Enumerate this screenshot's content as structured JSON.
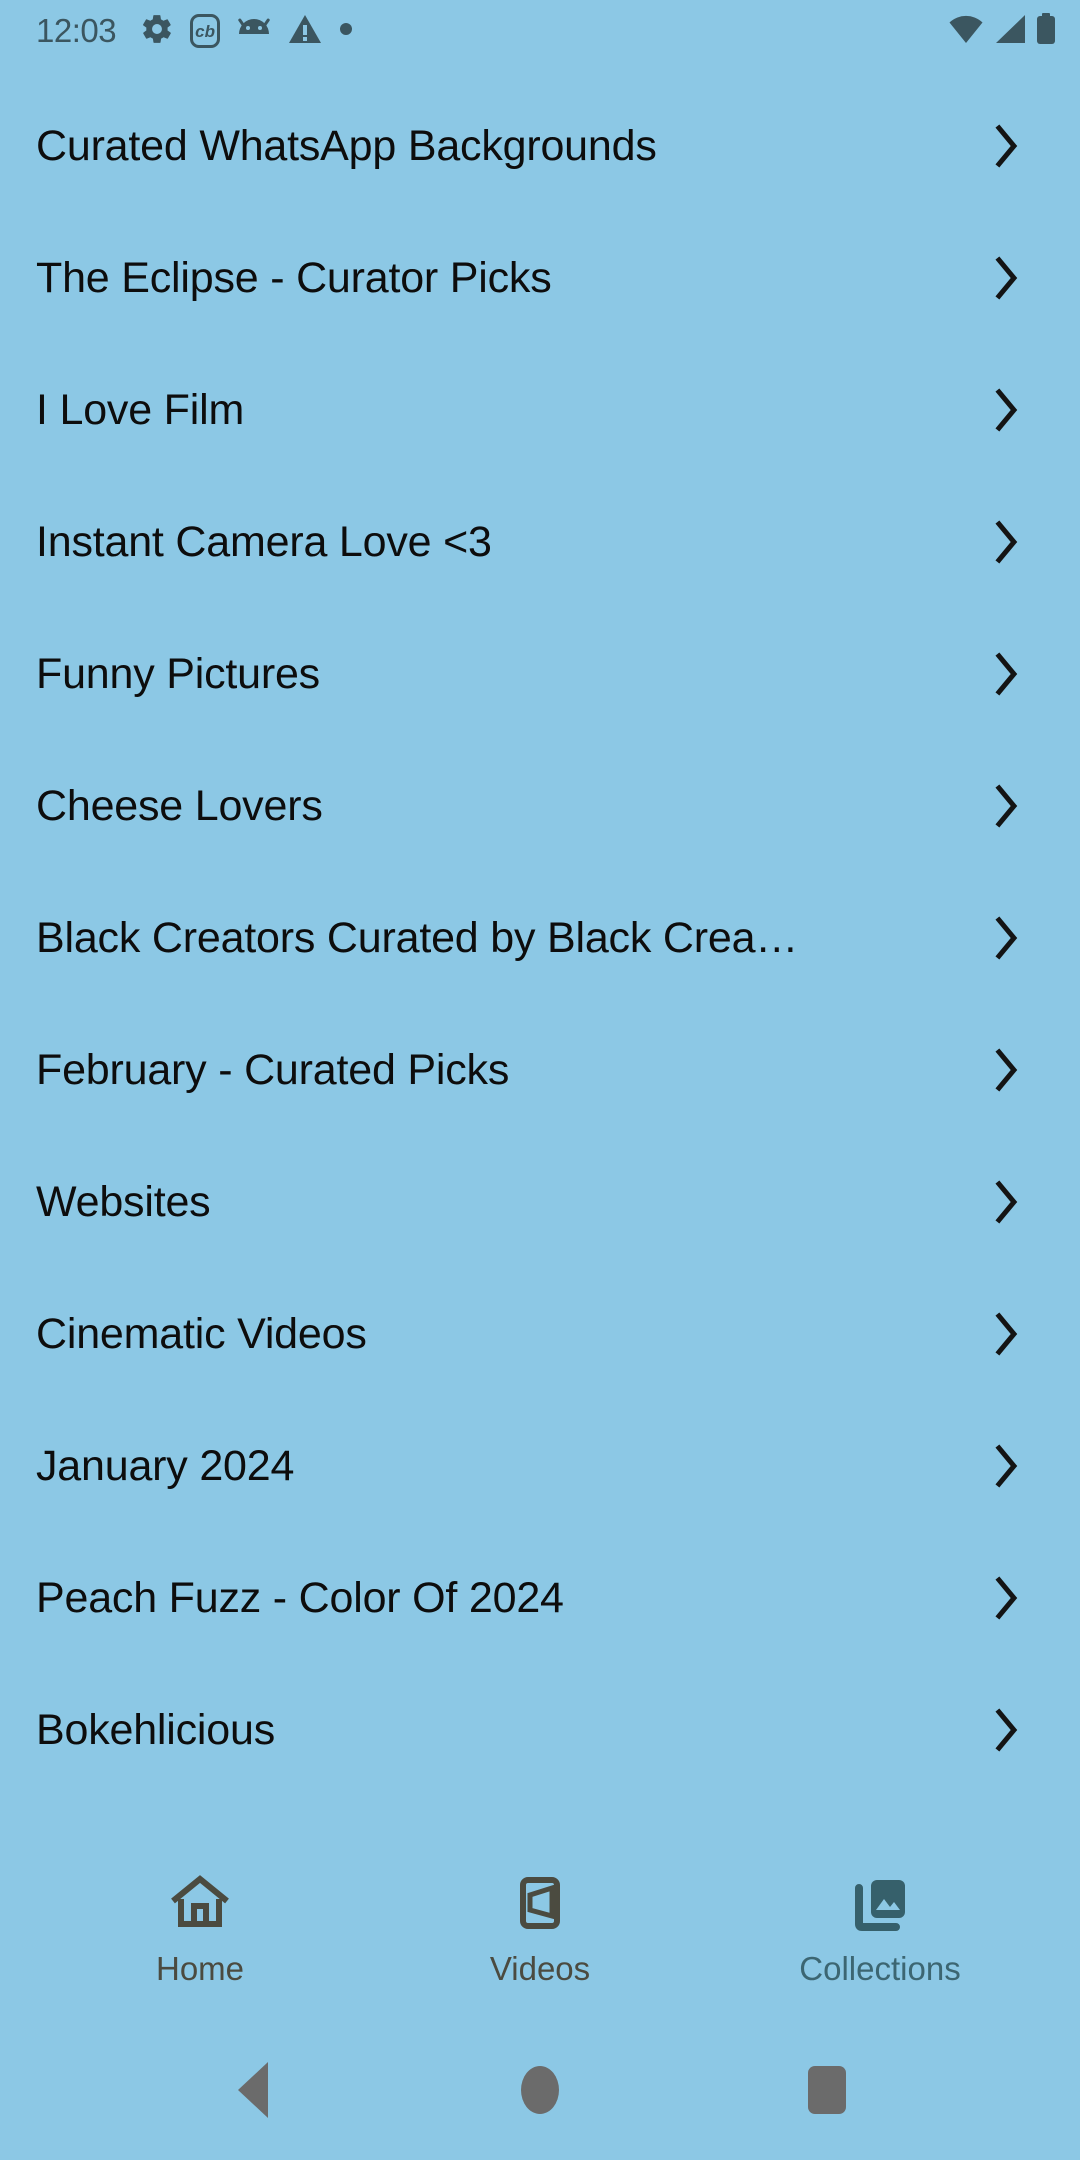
{
  "status_bar": {
    "time": "12:03",
    "left_icons": [
      "gear-icon",
      "cb-badge-icon",
      "android-icon",
      "warning-triangle-icon",
      "dot-icon"
    ],
    "cb_badge_text": "cb",
    "right_icons": [
      "wifi-icon",
      "cell-signal-icon",
      "battery-icon"
    ]
  },
  "colors": {
    "background": "#8cc8e5",
    "list_text": "#0d0d0d",
    "status_icon": "#3b5660",
    "nav_icon": "#4b4b40",
    "nav_selected": "#3c6672",
    "system_nav": "#6b6b6b"
  },
  "collections": {
    "items": [
      {
        "label": "Curated WhatsApp Backgrounds"
      },
      {
        "label": "The Eclipse - Curator Picks"
      },
      {
        "label": "I Love Film"
      },
      {
        "label": "Instant Camera Love <3"
      },
      {
        "label": "Funny Pictures"
      },
      {
        "label": "Cheese Lovers"
      },
      {
        "label": "Black Creators Curated by Black Crea…"
      },
      {
        "label": "February - Curated Picks"
      },
      {
        "label": "Websites"
      },
      {
        "label": "Cinematic Videos"
      },
      {
        "label": "January 2024"
      },
      {
        "label": "Peach Fuzz - Color Of 2024"
      },
      {
        "label": "Bokehlicious"
      }
    ]
  },
  "bottom_nav": {
    "tabs": [
      {
        "label": "Home",
        "icon": "home-icon",
        "selected": false
      },
      {
        "label": "Videos",
        "icon": "videos-icon",
        "selected": false
      },
      {
        "label": "Collections",
        "icon": "collections-icon",
        "selected": true
      }
    ]
  },
  "system_nav": {
    "buttons": [
      {
        "name": "back-button"
      },
      {
        "name": "home-button"
      },
      {
        "name": "recents-button"
      }
    ]
  }
}
